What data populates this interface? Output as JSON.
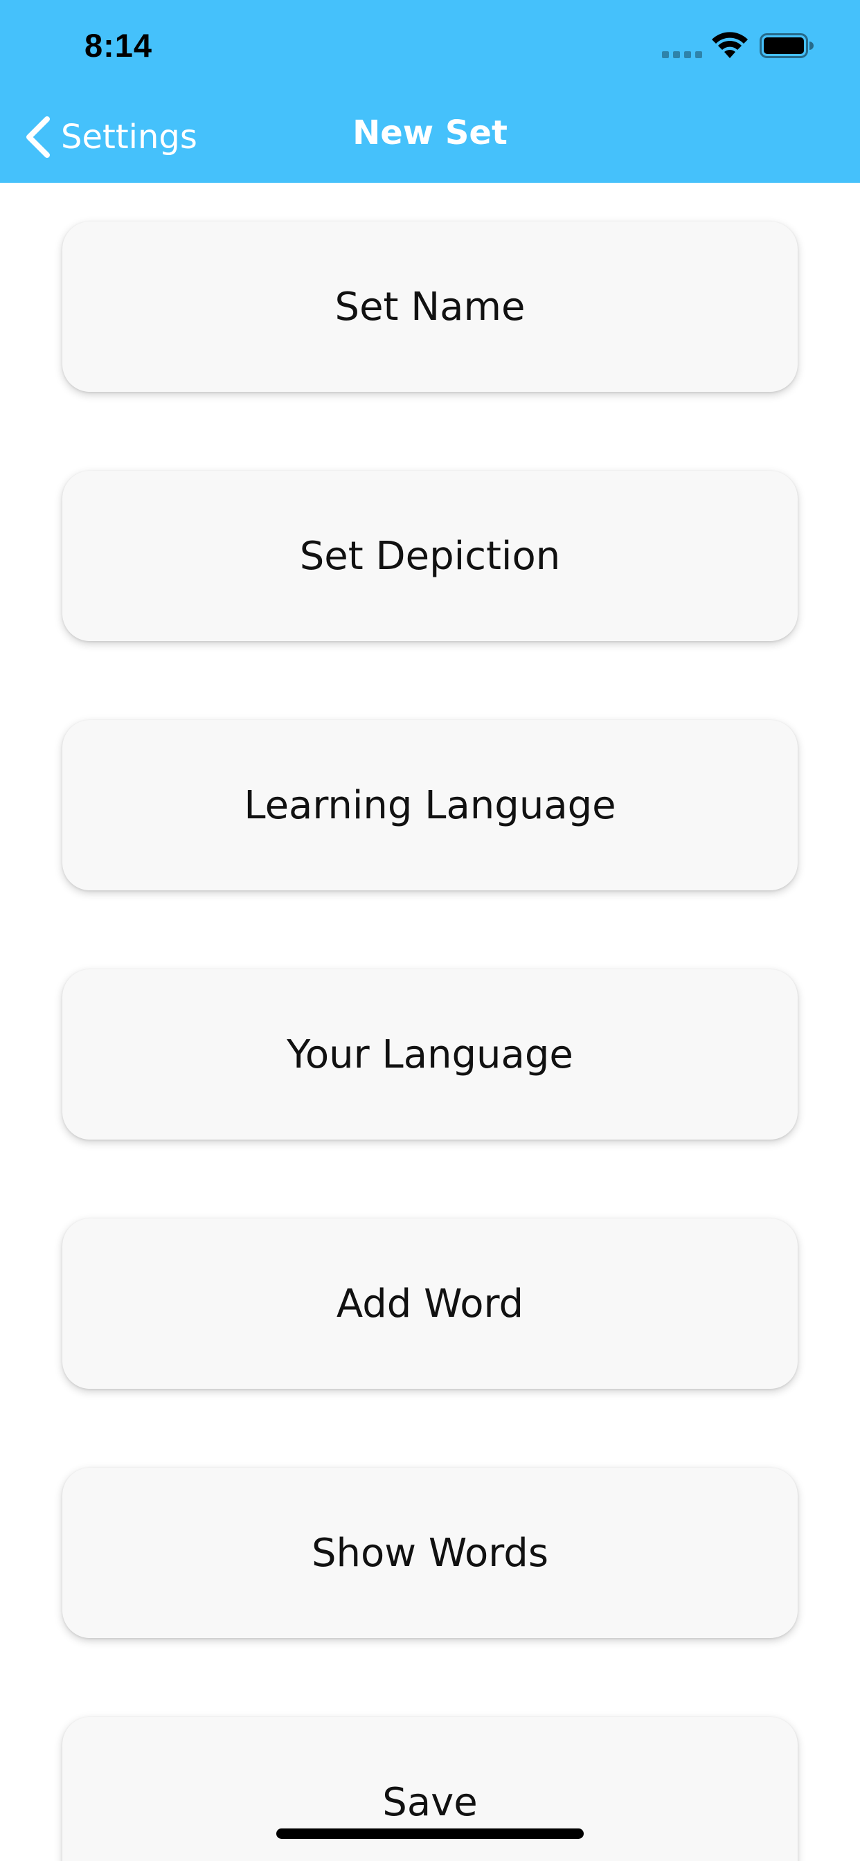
{
  "status_bar": {
    "time": "8:14"
  },
  "nav": {
    "back_label": "Settings",
    "title": "New Set"
  },
  "cards": [
    {
      "label": "Set Name"
    },
    {
      "label": "Set Depiction"
    },
    {
      "label": "Learning Language"
    },
    {
      "label": "Your Language"
    },
    {
      "label": "Add Word"
    },
    {
      "label": "Show Words"
    },
    {
      "label": "Save"
    }
  ],
  "colors": {
    "nav_bar": "#45c1fb",
    "card_background": "#f8f8f8",
    "nav_text": "#ffffff",
    "card_text": "#111111"
  },
  "icons": {
    "back": "chevron-left-icon",
    "signal": "cellular-signal-icon",
    "wifi": "wifi-icon",
    "battery": "battery-icon"
  }
}
